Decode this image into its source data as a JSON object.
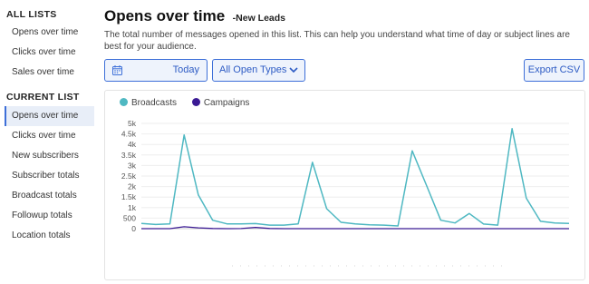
{
  "sidebar": {
    "all_lists_heading": "ALL LISTS",
    "all_lists": [
      {
        "label": "Opens over time"
      },
      {
        "label": "Clicks over time"
      },
      {
        "label": "Sales over time"
      }
    ],
    "current_list_heading": "CURRENT LIST",
    "current_list": [
      {
        "label": "Opens over time",
        "active": true
      },
      {
        "label": "Clicks over time"
      },
      {
        "label": "New subscribers"
      },
      {
        "label": "Subscriber totals"
      },
      {
        "label": "Broadcast totals"
      },
      {
        "label": "Followup totals"
      },
      {
        "label": "Location totals"
      }
    ]
  },
  "header": {
    "title": "Opens over time",
    "subtitle": "-New Leads",
    "description": "The total number of messages opened in this list. This can help you understand what time of day or subject lines are best for your audience."
  },
  "controls": {
    "date_label": "Today",
    "date_icon": "calendar-icon",
    "type_label": "All Open Types",
    "type_icon": "chevron-down-icon",
    "export_label": "Export CSV"
  },
  "colors": {
    "accent": "#3d6fd8",
    "broadcasts": "#4fb8c2",
    "campaigns": "#3b1a94"
  },
  "chart_data": {
    "type": "line",
    "ylim": [
      0,
      5000
    ],
    "yticks": [
      "0",
      "500",
      "1k",
      "1.5k",
      "2k",
      "2.5k",
      "3k",
      "3.5k",
      "4k",
      "4.5k",
      "5k"
    ],
    "grid": true,
    "legend_position": "top-left",
    "series": [
      {
        "name": "Broadcasts",
        "color": "#4fb8c2",
        "values": [
          250,
          200,
          230,
          4450,
          1600,
          400,
          230,
          230,
          240,
          170,
          170,
          230,
          3150,
          950,
          300,
          230,
          180,
          170,
          130,
          3700,
          2050,
          400,
          270,
          720,
          220,
          170,
          4750,
          1450,
          350,
          270,
          250
        ]
      },
      {
        "name": "Campaigns",
        "color": "#3b1a94",
        "values": [
          0,
          0,
          0,
          90,
          40,
          10,
          0,
          5,
          60,
          10,
          0,
          0,
          0,
          0,
          0,
          0,
          0,
          0,
          0,
          0,
          0,
          0,
          0,
          0,
          0,
          0,
          0,
          0,
          0,
          0,
          0
        ]
      }
    ]
  }
}
